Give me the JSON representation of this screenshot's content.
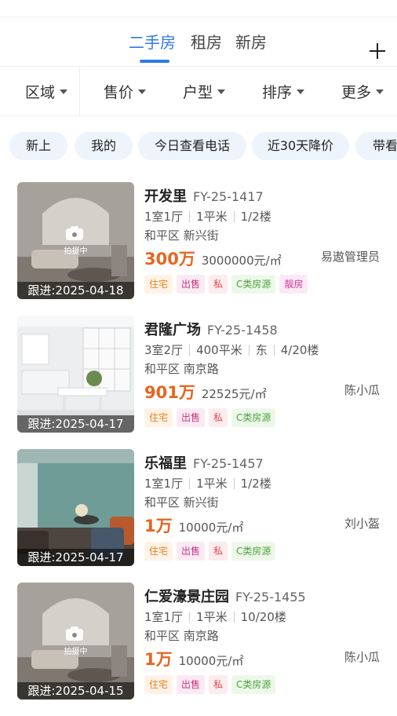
{
  "tabs": [
    {
      "label": "二手房",
      "active": true
    },
    {
      "label": "租房",
      "active": false
    },
    {
      "label": "新房",
      "active": false
    }
  ],
  "filters": [
    {
      "label": "区域"
    },
    {
      "label": "售价"
    },
    {
      "label": "户型"
    },
    {
      "label": "排序"
    },
    {
      "label": "更多"
    }
  ],
  "chips": [
    {
      "label": "新上"
    },
    {
      "label": "我的"
    },
    {
      "label": "今日查看电话"
    },
    {
      "label": "近30天降价"
    },
    {
      "label": "带看"
    }
  ],
  "listings": [
    {
      "name": "开发里",
      "code": "FY-25-1417",
      "specs": [
        "1室1厅",
        "1平米",
        "1/2楼"
      ],
      "location": "和平区 新兴街",
      "price": "300万",
      "unit_price": "3000000元/㎡",
      "agent": "易遨管理员",
      "follow_up": "跟进:2025-04-18",
      "photo": "placeholder",
      "camera_label": "拍摄中",
      "tags": [
        {
          "text": "住宅",
          "color": "orange"
        },
        {
          "text": "出售",
          "color": "pink"
        },
        {
          "text": "私",
          "color": "red"
        },
        {
          "text": "C类房源",
          "color": "green"
        },
        {
          "text": "靓房",
          "color": "magenta"
        }
      ]
    },
    {
      "name": "君隆广场",
      "code": "FY-25-1458",
      "specs": [
        "3室2厅",
        "400平米",
        "东",
        "4/20楼"
      ],
      "location": "和平区 南京路",
      "price": "901万",
      "unit_price": "22525元/㎡",
      "agent": "陈小瓜",
      "follow_up": "跟进:2025-04-17",
      "photo": "white-kitchen",
      "tags": [
        {
          "text": "住宅",
          "color": "orange"
        },
        {
          "text": "出售",
          "color": "pink"
        },
        {
          "text": "私",
          "color": "red"
        },
        {
          "text": "C类房源",
          "color": "green"
        }
      ]
    },
    {
      "name": "乐福里",
      "code": "FY-25-1457",
      "specs": [
        "1室1厅",
        "1平米",
        "1/2楼"
      ],
      "location": "和平区 新兴街",
      "price": "1万",
      "unit_price": "10000元/㎡",
      "agent": "刘小盔",
      "follow_up": "跟进:2025-04-17",
      "photo": "teal-livingroom",
      "tags": [
        {
          "text": "住宅",
          "color": "orange"
        },
        {
          "text": "出售",
          "color": "pink"
        },
        {
          "text": "私",
          "color": "red"
        },
        {
          "text": "C类房源",
          "color": "green"
        }
      ]
    },
    {
      "name": "仁爱濠景庄园",
      "code": "FY-25-1455",
      "specs": [
        "1室1厅",
        "1平米",
        "10/20楼"
      ],
      "location": "和平区 南京路",
      "price": "1万",
      "unit_price": "10000元/㎡",
      "agent": "陈小瓜",
      "follow_up": "跟进:2025-04-15",
      "photo": "placeholder",
      "camera_label": "拍摄中",
      "tags": [
        {
          "text": "住宅",
          "color": "orange"
        },
        {
          "text": "出售",
          "color": "pink"
        },
        {
          "text": "私",
          "color": "red"
        },
        {
          "text": "C类房源",
          "color": "green"
        }
      ]
    }
  ],
  "colors": {
    "accent": "#2f7ae5",
    "price": "#e8641e",
    "chip_bg": "#eef4fb"
  },
  "icons": {
    "add": "plus-icon",
    "dropdown": "caret-down-icon",
    "camera": "camera-icon"
  }
}
